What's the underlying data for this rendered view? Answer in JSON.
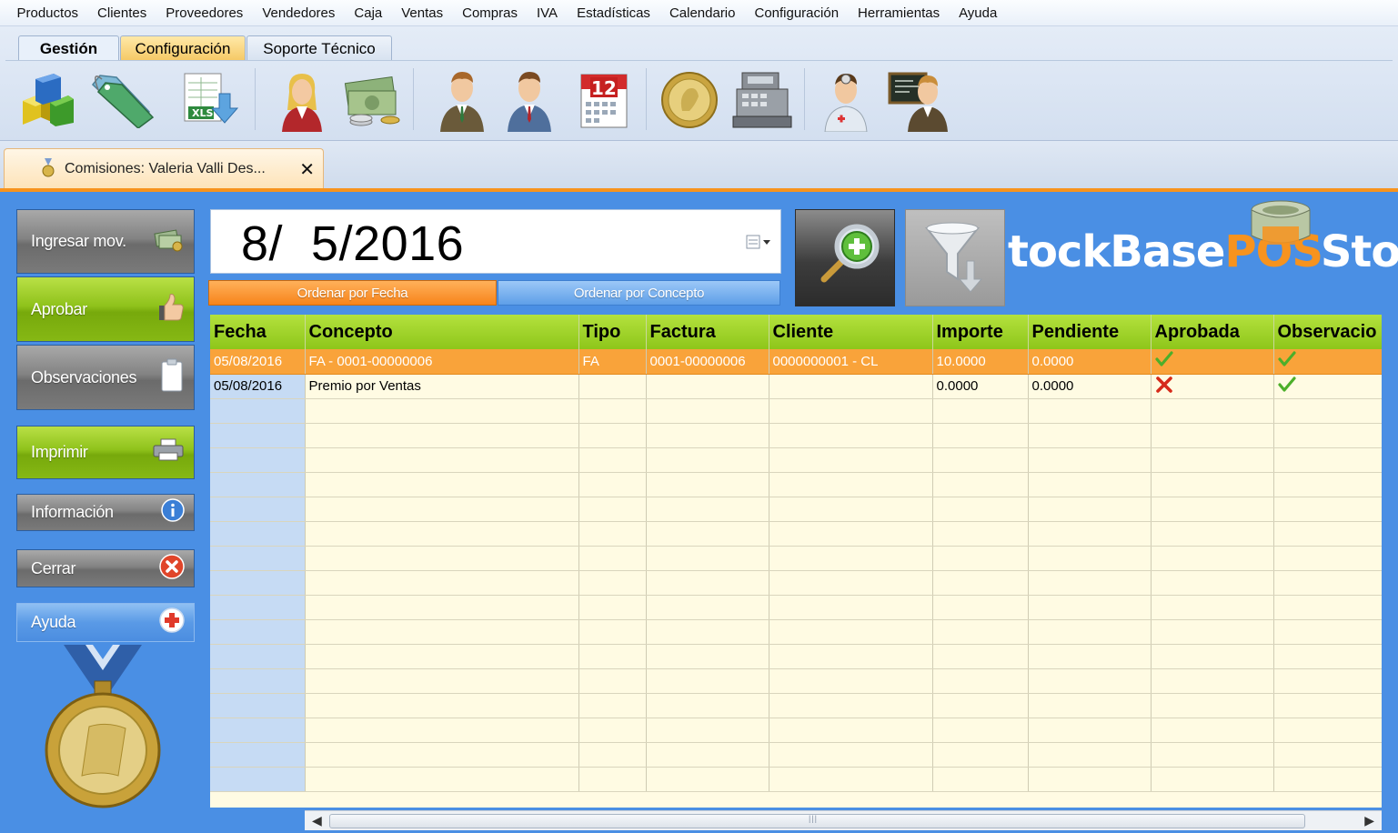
{
  "menu": [
    "Productos",
    "Clientes",
    "Proveedores",
    "Vendedores",
    "Caja",
    "Ventas",
    "Compras",
    "IVA",
    "Estadísticas",
    "Calendario",
    "Configuración",
    "Herramientas",
    "Ayuda"
  ],
  "ribbon_tabs": {
    "gestion": "Gestión",
    "configuracion": "Configuración",
    "soporte": "Soporte Técnico"
  },
  "ribbon_icon_text": {
    "xls": "XLS",
    "calendar_day": "12"
  },
  "document_tab": {
    "title": "Comisiones: Valeria Valli  Des...",
    "close": "✕"
  },
  "sidebar": {
    "ingresar": "Ingresar mov.",
    "aprobar": "Aprobar",
    "observaciones": "Observaciones",
    "imprimir": "Imprimir",
    "informacion": "Información",
    "cerrar": "Cerrar",
    "ayuda": "Ayuda"
  },
  "date_field": {
    "value": "8/  5/2016"
  },
  "sort": {
    "fecha": "Ordenar por Fecha",
    "concepto": "Ordenar por Concepto"
  },
  "logo": {
    "part1": "tockBase",
    "part2": "POS",
    "part3": "Sto"
  },
  "grid": {
    "columns": [
      "Fecha",
      "Concepto",
      "Tipo",
      "Factura",
      "Cliente",
      "Importe",
      "Pendiente",
      "Aprobada",
      "Observacio"
    ],
    "rows": [
      {
        "fecha": "05/08/2016",
        "concepto": "FA  -  0001-00000006",
        "tipo": "FA",
        "factura": "0001-00000006",
        "cliente": "0000000001 - CL",
        "importe": "10.0000",
        "pendiente": "0.0000",
        "aprobada": "check",
        "observacion": "check"
      },
      {
        "fecha": "05/08/2016",
        "concepto": "Premio por Ventas",
        "tipo": "",
        "factura": "",
        "cliente": "",
        "importe": "0.0000",
        "pendiente": "0.0000",
        "aprobada": "cross",
        "observacion": "check"
      }
    ]
  },
  "colors": {
    "accent_orange": "#f7931e",
    "panel_blue": "#4a8fe4",
    "header_green": "#9ed02a",
    "grid_bg": "#fffbe3"
  }
}
